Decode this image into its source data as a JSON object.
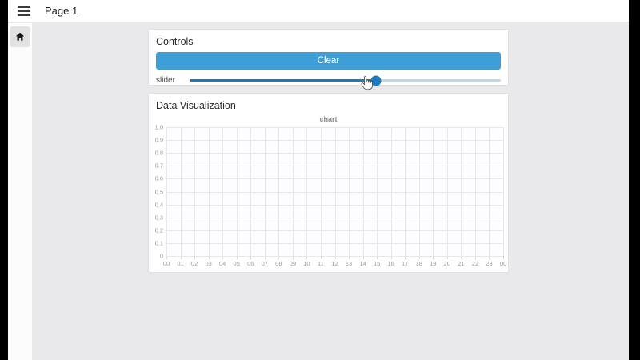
{
  "header": {
    "title": "Page 1"
  },
  "sidebar": {
    "home_icon": "home-icon"
  },
  "controls": {
    "title": "Controls",
    "clear_label": "Clear",
    "slider_label": "slider",
    "slider_value_pct": 60
  },
  "visualization": {
    "title": "Data Visualization"
  },
  "chart_data": {
    "type": "line",
    "title": "chart",
    "xlabel": "",
    "ylabel": "",
    "x_ticks": [
      "00",
      "01",
      "02",
      "03",
      "04",
      "05",
      "06",
      "07",
      "08",
      "09",
      "10",
      "11",
      "12",
      "13",
      "14",
      "15",
      "16",
      "17",
      "18",
      "19",
      "20",
      "21",
      "22",
      "23",
      "00"
    ],
    "y_ticks": [
      "1.0",
      "0.9",
      "0.8",
      "0.7",
      "0.6",
      "0.5",
      "0.4",
      "0.3",
      "0.2",
      "0.1",
      "0"
    ],
    "ylim": [
      0,
      1
    ],
    "grid": true,
    "legend": "none",
    "series": []
  },
  "colors": {
    "accent_button": "#3d9fd6",
    "slider_fill": "#1b79c0",
    "slider_rail": "#b9d9ee",
    "main_background": "#e9e8ea",
    "edge_bars": "#000000"
  }
}
